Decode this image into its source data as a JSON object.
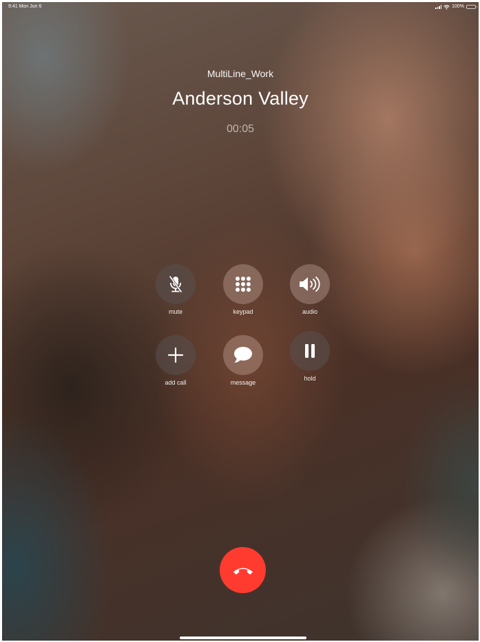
{
  "status_bar": {
    "time_date": "9:41  Mon Jun 6",
    "battery_percent": "100%",
    "battery_level": 1.0,
    "signal_icon": "cellular-signal-icon",
    "wifi_icon": "wifi-icon",
    "battery_icon": "battery-icon"
  },
  "call": {
    "line": "MultiLine_Work",
    "caller": "Anderson Valley",
    "timer": "00:05"
  },
  "controls": {
    "mute": {
      "label": "mute",
      "icon": "mic-slash-icon"
    },
    "keypad": {
      "label": "keypad",
      "icon": "keypad-grid-icon"
    },
    "audio": {
      "label": "audio",
      "icon": "speaker-icon"
    },
    "add_call": {
      "label": "add call",
      "icon": "plus-icon"
    },
    "message": {
      "label": "message",
      "icon": "message-bubble-icon"
    },
    "hold": {
      "label": "hold",
      "icon": "pause-icon"
    }
  },
  "end_call": {
    "icon": "end-call-phone-icon",
    "color": "#ff3b30"
  }
}
